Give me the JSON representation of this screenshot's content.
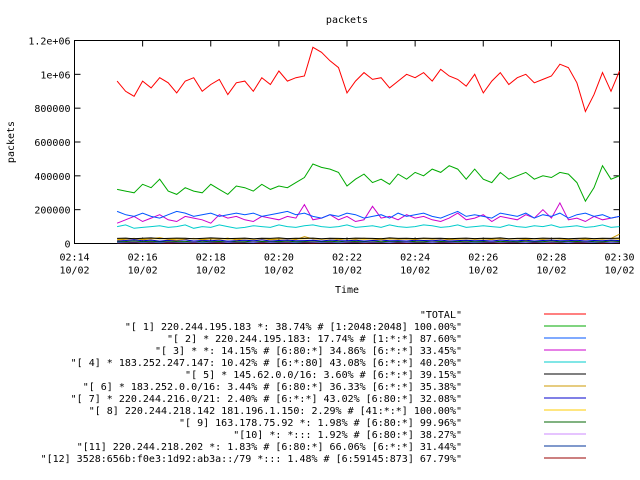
{
  "chart_data": {
    "type": "line",
    "title": "packets",
    "xlabel": "Time",
    "ylabel": "packets",
    "xlim": [
      "02:14:00",
      "02:30:00"
    ],
    "ylim": [
      0,
      1200000
    ],
    "yticks": [
      {
        "value": 0,
        "label": "0"
      },
      {
        "value": 200000,
        "label": "200000"
      },
      {
        "value": 400000,
        "label": "400000"
      },
      {
        "value": 600000,
        "label": "600000"
      },
      {
        "value": 800000,
        "label": "800000"
      },
      {
        "value": 1000000,
        "label": "1e+06"
      },
      {
        "value": 1200000,
        "label": "1.2e+06"
      }
    ],
    "xticks": [
      {
        "time": "02:14",
        "date": "10/02"
      },
      {
        "time": "02:16",
        "date": "10/02"
      },
      {
        "time": "02:18",
        "date": "10/02"
      },
      {
        "time": "02:20",
        "date": "10/02"
      },
      {
        "time": "02:22",
        "date": "10/02"
      },
      {
        "time": "02:24",
        "date": "10/02"
      },
      {
        "time": "02:26",
        "date": "10/02"
      },
      {
        "time": "02:28",
        "date": "10/02"
      },
      {
        "time": "02:30",
        "date": "10/02"
      }
    ],
    "grid": false,
    "legend_position": "below",
    "x": [
      "02:15:15",
      "02:15:30",
      "02:15:45",
      "02:16:00",
      "02:16:15",
      "02:16:30",
      "02:16:45",
      "02:17:00",
      "02:17:15",
      "02:17:30",
      "02:17:45",
      "02:18:00",
      "02:18:15",
      "02:18:30",
      "02:18:45",
      "02:19:00",
      "02:19:15",
      "02:19:30",
      "02:19:45",
      "02:20:00",
      "02:20:15",
      "02:20:30",
      "02:20:45",
      "02:21:00",
      "02:21:15",
      "02:21:30",
      "02:21:45",
      "02:22:00",
      "02:22:15",
      "02:22:30",
      "02:22:45",
      "02:23:00",
      "02:23:15",
      "02:23:30",
      "02:23:45",
      "02:24:00",
      "02:24:15",
      "02:24:30",
      "02:24:45",
      "02:25:00",
      "02:25:15",
      "02:25:30",
      "02:25:45",
      "02:26:00",
      "02:26:15",
      "02:26:30",
      "02:26:45",
      "02:27:00",
      "02:27:15",
      "02:27:30",
      "02:27:45",
      "02:28:00",
      "02:28:15",
      "02:28:30",
      "02:28:45",
      "02:29:00",
      "02:29:15",
      "02:29:30",
      "02:29:45",
      "02:30:00"
    ],
    "series": [
      {
        "name": "\"TOTAL\"",
        "color": "#ff0000",
        "values": [
          960000,
          900000,
          870000,
          960000,
          920000,
          980000,
          950000,
          890000,
          960000,
          980000,
          900000,
          940000,
          970000,
          880000,
          950000,
          960000,
          900000,
          980000,
          940000,
          1020000,
          960000,
          980000,
          990000,
          1160000,
          1130000,
          1080000,
          1040000,
          890000,
          960000,
          1010000,
          970000,
          980000,
          920000,
          960000,
          1000000,
          980000,
          1010000,
          960000,
          1030000,
          990000,
          970000,
          930000,
          1000000,
          890000,
          960000,
          1010000,
          940000,
          980000,
          1000000,
          950000,
          970000,
          990000,
          1060000,
          1040000,
          950000,
          780000,
          880000,
          1010000,
          900000,
          1020000
        ]
      },
      {
        "name": "\"[ 1] 220.244.195.183 *: 38.74% # [1:2048:2048] 100.00%\"",
        "color": "#00aa00",
        "values": [
          320000,
          310000,
          300000,
          350000,
          330000,
          380000,
          310000,
          290000,
          330000,
          310000,
          300000,
          350000,
          320000,
          290000,
          340000,
          330000,
          310000,
          350000,
          320000,
          340000,
          330000,
          360000,
          390000,
          470000,
          450000,
          440000,
          420000,
          340000,
          380000,
          410000,
          360000,
          380000,
          350000,
          410000,
          380000,
          420000,
          400000,
          440000,
          420000,
          460000,
          440000,
          380000,
          440000,
          380000,
          360000,
          420000,
          380000,
          400000,
          420000,
          380000,
          400000,
          390000,
          420000,
          410000,
          360000,
          250000,
          330000,
          460000,
          380000,
          400000
        ]
      },
      {
        "name": "\"[ 2] * 220.244.195.183: 17.74% # [1:*:*] 87.60%\"",
        "color": "#0055ff",
        "values": [
          190000,
          170000,
          160000,
          180000,
          160000,
          150000,
          170000,
          190000,
          180000,
          160000,
          170000,
          180000,
          160000,
          170000,
          180000,
          170000,
          180000,
          160000,
          170000,
          180000,
          190000,
          170000,
          180000,
          160000,
          150000,
          170000,
          160000,
          180000,
          170000,
          150000,
          160000,
          170000,
          150000,
          180000,
          160000,
          170000,
          180000,
          160000,
          150000,
          170000,
          190000,
          160000,
          170000,
          160000,
          150000,
          180000,
          170000,
          160000,
          180000,
          150000,
          170000,
          160000,
          180000,
          150000,
          170000,
          180000,
          160000,
          170000,
          150000,
          160000
        ]
      },
      {
        "name": "\"[ 3] * *: 14.15% # [6:80:*] 34.86% [6:*:*] 33.45%\"",
        "color": "#cc00cc",
        "values": [
          120000,
          140000,
          160000,
          130000,
          150000,
          170000,
          140000,
          130000,
          160000,
          150000,
          140000,
          120000,
          170000,
          150000,
          160000,
          140000,
          130000,
          160000,
          150000,
          140000,
          160000,
          150000,
          230000,
          140000,
          150000,
          170000,
          140000,
          160000,
          130000,
          140000,
          220000,
          150000,
          160000,
          140000,
          170000,
          150000,
          160000,
          140000,
          130000,
          150000,
          180000,
          140000,
          150000,
          170000,
          130000,
          160000,
          150000,
          140000,
          170000,
          150000,
          200000,
          150000,
          240000,
          140000,
          150000,
          130000,
          160000,
          140000,
          150000,
          160000
        ]
      },
      {
        "name": "\"[ 4] * 183.252.247.147: 10.42% # [6:*:80] 43.08% [6:*:*] 40.20%\"",
        "color": "#00cccc",
        "values": [
          100000,
          110000,
          90000,
          95000,
          100000,
          105000,
          95000,
          100000,
          110000,
          90000,
          100000,
          95000,
          110000,
          100000,
          90000,
          95000,
          105000,
          100000,
          95000,
          110000,
          100000,
          95000,
          105000,
          110000,
          100000,
          95000,
          100000,
          110000,
          95000,
          100000,
          105000,
          95000,
          110000,
          100000,
          95000,
          100000,
          110000,
          105000,
          95000,
          100000,
          110000,
          95000,
          100000,
          105000,
          100000,
          95000,
          110000,
          100000,
          95000,
          105000,
          100000,
          110000,
          95000,
          100000,
          105000,
          95000,
          100000,
          110000,
          95000,
          100000
        ]
      },
      {
        "name": "\"[ 5] * 145.62.0.0/16: 3.60% # [6:*:*] 39.15%\"",
        "color": "#000000",
        "values": [
          30000,
          32000,
          28000,
          31000,
          33000,
          29000,
          30000,
          32000,
          31000,
          28000,
          30000,
          33000,
          31000,
          29000,
          30000,
          32000,
          28000,
          31000,
          30000,
          33000,
          29000,
          31000,
          30000,
          32000,
          28000,
          31000,
          30000,
          29000,
          32000,
          31000,
          30000,
          28000,
          33000,
          30000,
          31000,
          29000,
          32000,
          30000,
          31000,
          28000,
          30000,
          32000,
          29000,
          31000,
          30000,
          33000,
          28000,
          30000,
          31000,
          29000,
          32000,
          30000,
          31000,
          28000,
          30000,
          32000,
          29000,
          31000,
          30000,
          32000
        ]
      },
      {
        "name": "\"[ 6] * 183.252.0.0/16: 3.44% # [6:80:*] 36.33% [6:*:*] 35.38%\"",
        "color": "#cc9900",
        "values": [
          20000,
          25000,
          30000,
          22000,
          28000,
          35000,
          24000,
          20000,
          26000,
          30000,
          22000,
          27000,
          25000,
          32000,
          21000,
          28000,
          24000,
          30000,
          22000,
          26000,
          29000,
          23000,
          40000,
          27000,
          25000,
          30000,
          22000,
          28000,
          24000,
          31000,
          26000,
          22000,
          29000,
          24000,
          27000,
          23000,
          30000,
          25000,
          28000,
          22000,
          26000,
          29000,
          24000,
          27000,
          23000,
          30000,
          25000,
          28000,
          22000,
          27000,
          24000,
          30000,
          26000,
          23000,
          28000,
          22000,
          27000,
          25000,
          30000,
          55000
        ]
      },
      {
        "name": "\"[ 7] * 220.244.216.0/21: 2.40% # [6:*:*] 43.02% [6:80:*] 32.08%\"",
        "color": "#0000cc",
        "values": [
          15000,
          18000,
          22000,
          16000,
          20000,
          14000,
          19000,
          17000,
          21000,
          15000,
          18000,
          16000,
          20000,
          14000,
          17000,
          19000,
          16000,
          21000,
          15000,
          18000,
          20000,
          16000,
          17000,
          19000,
          15000,
          20000,
          17000,
          16000,
          19000,
          15000,
          18000,
          20000,
          16000,
          17000,
          15000,
          19000,
          18000,
          16000,
          20000,
          15000,
          17000,
          19000,
          16000,
          18000,
          15000,
          20000,
          17000,
          16000,
          19000,
          15000,
          18000,
          20000,
          16000,
          17000,
          19000,
          15000,
          18000,
          16000,
          20000,
          17000
        ]
      },
      {
        "name": "\"[ 8] 220.244.218.142 181.196.1.150: 2.29% # [41:*:*] 100.00%\"",
        "color": "#ffcc00",
        "values": [
          25000,
          28000,
          30000,
          26000,
          27000,
          29000,
          25000,
          28000,
          30000,
          27000,
          26000,
          28000,
          29000,
          25000,
          27000,
          30000,
          26000,
          28000,
          25000,
          27000,
          29000,
          26000,
          28000,
          30000,
          25000,
          27000,
          29000,
          26000,
          28000,
          25000,
          27000,
          30000,
          26000,
          28000,
          25000,
          29000,
          27000,
          26000,
          28000,
          30000,
          25000,
          27000,
          29000,
          26000,
          28000,
          25000,
          27000,
          30000,
          26000,
          28000,
          25000,
          29000,
          27000,
          26000,
          28000,
          30000,
          25000,
          27000,
          29000,
          26000
        ]
      },
      {
        "name": "\"[ 9] 163.178.75.92 *: 1.98% # [6:80:*] 99.96%\"",
        "color": "#006600",
        "values": [
          10000,
          12000,
          15000,
          11000,
          13000,
          10000,
          14000,
          12000,
          11000,
          15000,
          10000,
          13000,
          12000,
          14000,
          11000,
          10000,
          15000,
          12000,
          13000,
          11000,
          14000,
          10000,
          12000,
          15000,
          11000,
          13000,
          10000,
          14000,
          12000,
          11000,
          15000,
          10000,
          13000,
          12000,
          14000,
          11000,
          10000,
          15000,
          12000,
          13000,
          11000,
          14000,
          10000,
          12000,
          15000,
          11000,
          13000,
          10000,
          14000,
          12000,
          11000,
          15000,
          10000,
          13000,
          12000,
          14000,
          11000,
          10000,
          15000,
          12000
        ]
      },
      {
        "name": "\"[10] *: *::: 1.92% # [6:80:*] 38.27%\"",
        "color": "#cc88ff",
        "values": [
          8000,
          10000,
          12000,
          9000,
          11000,
          8000,
          12000,
          10000,
          9000,
          11000,
          8000,
          10000,
          12000,
          9000,
          11000,
          10000,
          8000,
          12000,
          9000,
          10000,
          11000,
          8000,
          12000,
          10000,
          9000,
          11000,
          8000,
          10000,
          12000,
          9000,
          11000,
          10000,
          8000,
          12000,
          9000,
          10000,
          11000,
          8000,
          12000,
          10000,
          9000,
          11000,
          8000,
          10000,
          12000,
          9000,
          11000,
          10000,
          8000,
          12000,
          9000,
          10000,
          11000,
          8000,
          12000,
          10000,
          9000,
          11000,
          8000,
          10000
        ]
      },
      {
        "name": "\"[11] 220.244.218.202 *: 1.83% # [6:80:*] 66.06% [6:*:*] 31.44%\"",
        "color": "#003399",
        "values": [
          5000,
          7000,
          9000,
          6000,
          8000,
          5000,
          9000,
          7000,
          6000,
          8000,
          5000,
          7000,
          9000,
          6000,
          8000,
          7000,
          5000,
          9000,
          6000,
          7000,
          8000,
          5000,
          9000,
          7000,
          6000,
          8000,
          5000,
          7000,
          9000,
          6000,
          8000,
          7000,
          5000,
          9000,
          6000,
          7000,
          8000,
          5000,
          9000,
          7000,
          6000,
          8000,
          5000,
          7000,
          9000,
          6000,
          8000,
          7000,
          5000,
          9000,
          6000,
          7000,
          8000,
          5000,
          9000,
          7000,
          6000,
          8000,
          5000,
          7000
        ]
      },
      {
        "name": "\"[12] 3528:656b:f0e3:1d92:ab3a::/79 *::: 1.48% # [6:59145:873] 67.79%\"",
        "color": "#990000",
        "values": [
          3000,
          4000,
          6000,
          3500,
          5000,
          4000,
          3000,
          5500,
          4000,
          3500,
          5000,
          4000,
          3000,
          6000,
          3500,
          4500,
          4000,
          3000,
          5000,
          4000,
          3500,
          5500,
          4000,
          3000,
          5000,
          4500,
          3500,
          4000,
          6000,
          3000,
          4000,
          5000,
          3500,
          4000,
          3000,
          5500,
          4000,
          3500,
          5000,
          4000,
          3000,
          6000,
          3500,
          4500,
          4000,
          3000,
          5000,
          4000,
          3500,
          5500,
          4000,
          3000,
          5000,
          4500,
          3500,
          4000,
          6000,
          3000,
          4000,
          5000
        ]
      }
    ]
  }
}
